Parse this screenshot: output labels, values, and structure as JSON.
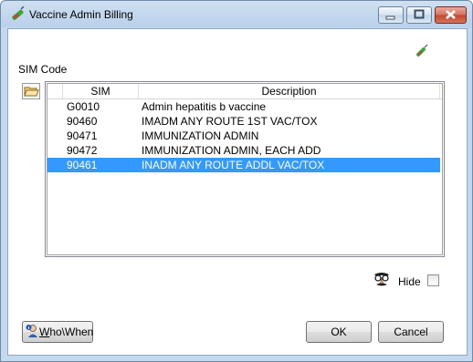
{
  "window": {
    "title": "Vaccine Admin Billing"
  },
  "labels": {
    "sim_code": "SIM Code",
    "hide": "Hide"
  },
  "table": {
    "columns": [
      "SIM",
      "Description"
    ],
    "rows": [
      {
        "sim": "G0010",
        "description": "Admin hepatitis b vaccine"
      },
      {
        "sim": "90460",
        "description": "IMADM ANY ROUTE 1ST VAC/TOX"
      },
      {
        "sim": "90471",
        "description": "IMMUNIZATION ADMIN"
      },
      {
        "sim": "90472",
        "description": "IMMUNIZATION ADMIN, EACH ADD"
      },
      {
        "sim": "90461",
        "description": "INADM ANY ROUTE ADDL VAC/TOX",
        "selected": true
      }
    ]
  },
  "buttons": {
    "who_prefix": "W",
    "who_rest": "ho\\When",
    "ok": "OK",
    "cancel": "Cancel"
  },
  "checkbox": {
    "hide_checked": false
  },
  "colors": {
    "selection": "#3399ff",
    "close": "#c1462c"
  },
  "icons": [
    "app-icon",
    "minimize-icon",
    "maximize-icon",
    "close-icon",
    "open-folder-icon",
    "syringe-icon",
    "disguise-icon",
    "info-person-icon"
  ]
}
